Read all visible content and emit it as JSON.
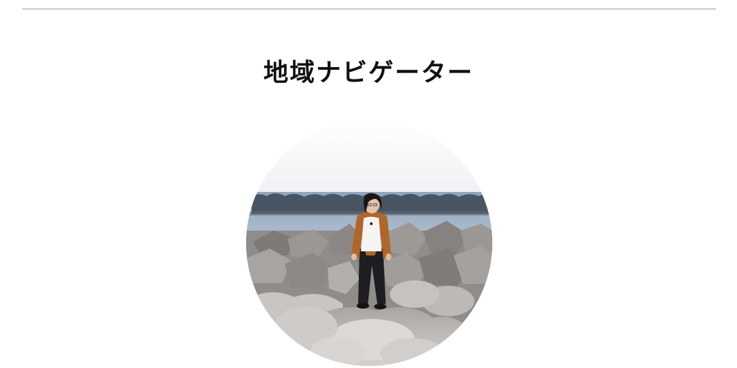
{
  "section": {
    "title": "地域ナビゲーター"
  },
  "photo": {
    "subject": "person-standing-on-tetrapods-by-sea",
    "colors": {
      "sky": "#f3f4f6",
      "sea": "#9fb3c6",
      "breakwater": "#4a5564",
      "rock_light": "#c8c4c1",
      "rock_mid": "#9a9794",
      "rock_dark": "#6a6866",
      "jacket": "#b0662a",
      "shirt": "#f4f4f2",
      "pants": "#1d1d22",
      "hair": "#1a1614"
    }
  }
}
